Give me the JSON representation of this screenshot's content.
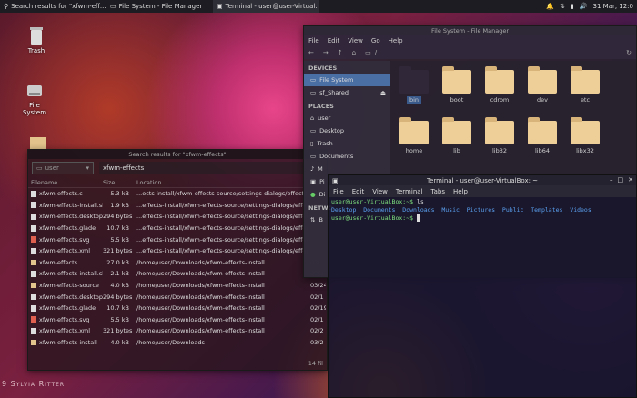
{
  "panel": {
    "tasks": [
      "Search results for \"xfwm-eff...",
      "File System - File Manager",
      "Terminal - user@user-Virtual..."
    ],
    "clock": "31 Mar, 12:0"
  },
  "desktop": {
    "icons": [
      {
        "label": "Trash"
      },
      {
        "label": "File System"
      }
    ],
    "watermark": "9 Sylvia Ritter"
  },
  "search": {
    "title": "Search results for \"xfwm-effects\"",
    "location": "user",
    "query": "xfwm-effects",
    "columns": [
      "Filename",
      "Size",
      "Location",
      ""
    ],
    "rows": [
      [
        "xfwm-effects.c",
        "5.3 kB",
        "...ects-install/xfwm-effects-source/settings-dialogs/effects/sr",
        ""
      ],
      [
        "xfwm-effects-install.sh",
        "1.9 kB",
        "...effects-install/xfwm-effects-source/settings-dialogs/effect",
        ""
      ],
      [
        "xfwm-effects.desktop",
        "294 bytes",
        "...effects-install/xfwm-effects-source/settings-dialogs/effect",
        ""
      ],
      [
        "xfwm-effects.glade",
        "10.7 kB",
        "...effects-install/xfwm-effects-source/settings-dialogs/effect",
        ""
      ],
      [
        "xfwm-effects.svg",
        "5.5 kB",
        "...effects-install/xfwm-effects-source/settings-dialogs/effect",
        ""
      ],
      [
        "xfwm-effects.xml",
        "321 bytes",
        "...effects-install/xfwm-effects-source/settings-dialogs/effect",
        ""
      ],
      [
        "xfwm-effects",
        "27.0 kB",
        "/home/user/Downloads/xfwm-effects-install",
        "03/"
      ],
      [
        "xfwm-effects-install.sh",
        "2.1 kB",
        "/home/user/Downloads/xfwm-effects-install",
        "02/2"
      ],
      [
        "xfwm-effects-source",
        "4.0 kB",
        "/home/user/Downloads/xfwm-effects-install",
        "03/24"
      ],
      [
        "xfwm-effects.desktop",
        "294 bytes",
        "/home/user/Downloads/xfwm-effects-install",
        "02/1"
      ],
      [
        "xfwm-effects.glade",
        "10.7 kB",
        "/home/user/Downloads/xfwm-effects-install",
        "02/19"
      ],
      [
        "xfwm-effects.svg",
        "5.5 kB",
        "/home/user/Downloads/xfwm-effects-install",
        "02/1"
      ],
      [
        "xfwm-effects.xml",
        "321 bytes",
        "/home/user/Downloads/xfwm-effects-install",
        "02/2"
      ],
      [
        "xfwm-effects-install",
        "4.0 kB",
        "/home/user/Downloads",
        "03/2"
      ]
    ],
    "status": "14 fil"
  },
  "fm": {
    "title": "File System - File Manager",
    "menu": [
      "File",
      "Edit",
      "View",
      "Go",
      "Help"
    ],
    "path": "/",
    "devices_h": "DEVICES",
    "places_h": "PLACES",
    "network_h": "NETWO",
    "devices": [
      "File System",
      "sf_Shared"
    ],
    "places": [
      "user",
      "Desktop",
      "Trash",
      "Documents",
      "M",
      "Pi",
      "Di"
    ],
    "network": [
      "B"
    ],
    "folders": [
      "bin",
      "boot",
      "cdrom",
      "dev",
      "etc",
      "home",
      "lib",
      "lib32",
      "lib64",
      "libx32"
    ]
  },
  "term": {
    "title": "Terminal - user@user-VirtualBox: ~",
    "menu": [
      "File",
      "Edit",
      "View",
      "Terminal",
      "Tabs",
      "Help"
    ],
    "prompt": "user@user-VirtualBox:~$",
    "cmd": " ls",
    "ls": [
      "Desktop",
      "Documents",
      "Downloads",
      "Music",
      "Pictures",
      "Public",
      "Templates",
      "Videos"
    ]
  }
}
